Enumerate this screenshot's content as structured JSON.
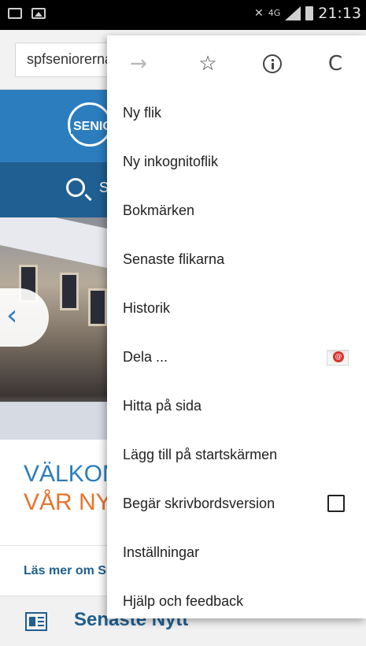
{
  "status_bar": {
    "network": "4G",
    "time": "21:13",
    "icons": [
      "sim-icon",
      "image-icon",
      "mute-icon",
      "signal-icon",
      "battery-icon"
    ]
  },
  "address_bar": {
    "url": "spfseniorerna.se"
  },
  "page": {
    "logo_text": "SENIORERNA",
    "search_label": "Sök",
    "welcome_line1": "VÄLKOMMEN TILL",
    "welcome_line2": "VÅR NYA WEBBPLATS",
    "read_more": "Läs mer om SPF Seniorerna",
    "news_title": "Senaste Nytt"
  },
  "menu": {
    "toolbar": {
      "forward": "→",
      "bookmark": "☆",
      "reload": "C"
    },
    "items": [
      {
        "label": "Ny flik"
      },
      {
        "label": "Ny inkognitoflik"
      },
      {
        "label": "Bokmärken"
      },
      {
        "label": "Senaste flikarna"
      },
      {
        "label": "Historik"
      },
      {
        "label": "Dela ..."
      },
      {
        "label": "Hitta på sida"
      },
      {
        "label": "Lägg till på startskärmen"
      },
      {
        "label": "Begär skrivbordsversion",
        "checked": false
      },
      {
        "label": "Inställningar"
      },
      {
        "label": "Hjälp och feedback"
      }
    ]
  },
  "colors": {
    "site_blue": "#2b7dbe",
    "site_dark_blue": "#1f5f91",
    "welcome_orange": "#e8742d"
  }
}
